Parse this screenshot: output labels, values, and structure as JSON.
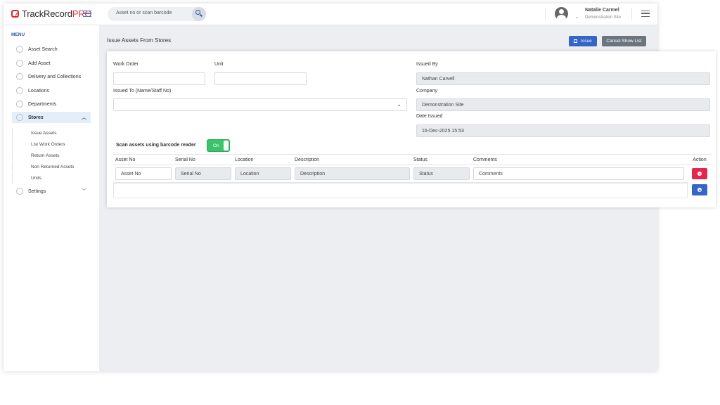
{
  "header": {
    "logo_brand": "TrackRecord",
    "logo_suffix": "PRO",
    "search_placeholder": "Asset no or scan barcode",
    "user_name": "Natalie Carmel",
    "user_site": "Demonstration Site",
    "icons": [
      "logo-icon",
      "hamburger-icon",
      "search-icon",
      "avatar-icon",
      "chevron-down-icon",
      "menu-icon"
    ]
  },
  "sidebar": {
    "heading": "MENU",
    "items": [
      {
        "label": "Asset Search",
        "icon": "search-icon"
      },
      {
        "label": "Add Asset",
        "icon": "add-icon"
      },
      {
        "label": "Delivery and Collections",
        "icon": "truck-icon"
      },
      {
        "label": "Locations",
        "icon": "globe-icon"
      },
      {
        "label": "Departments",
        "icon": "sitemap-icon"
      },
      {
        "label": "Stores",
        "icon": "store-icon",
        "active": true
      },
      {
        "label": "Settings",
        "icon": "gear-icon"
      }
    ],
    "stores_sub": [
      "Issue Assets",
      "List Work Orders",
      "Return Assets",
      "Non Returned Assets",
      "Units"
    ]
  },
  "page": {
    "title": "Issue Assets From Stores",
    "issue_label": "Issue",
    "cancel_label": "Cancel Show List"
  },
  "form": {
    "work_order_label": "Work Order",
    "work_order_value": "",
    "unit_label": "Unit",
    "unit_value": "",
    "issued_to_label": "Issued To (Name/Staff No)",
    "issued_to_value": "",
    "issued_by_label": "Issued By",
    "issued_by_value": "Nathan Carvell",
    "company_label": "Company",
    "company_value": "Demonstration Site",
    "date_label": "Date Issued",
    "date_value": "16-Dec-2025 15:53",
    "scan_label": "Scan assets using barcode reader",
    "scan_toggle": "On"
  },
  "table": {
    "columns": [
      "Asset No",
      "Serial No",
      "Location",
      "Description",
      "Status",
      "Comments",
      "Action"
    ],
    "row_placeholders": [
      "Asset No",
      "Serial No",
      "Location",
      "Description",
      "Status",
      "Comments"
    ]
  },
  "colors": {
    "primary": "#3465c9",
    "danger": "#e3264c",
    "success": "#3cc46b",
    "secondary": "#6c757d",
    "brand_red": "#d9262f"
  }
}
